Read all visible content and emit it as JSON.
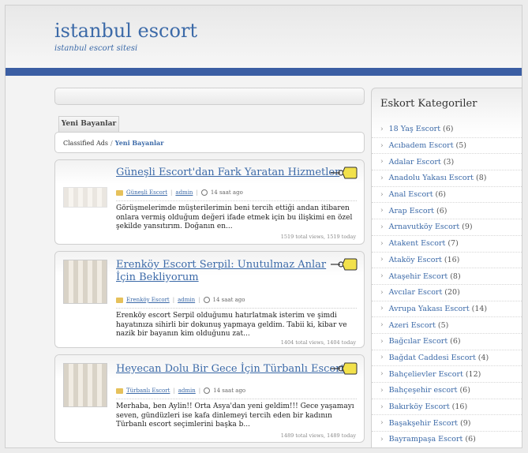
{
  "site": {
    "title": "istanbul escort",
    "tagline": "istanbul escort sitesi"
  },
  "tab_label": "Yeni Bayanlar",
  "breadcrumb": {
    "root": "Classified Ads",
    "separator": "/",
    "current": "Yeni Bayanlar"
  },
  "posts": [
    {
      "title": "Güneşli Escort'dan Fark Yaratan Hizmetler",
      "category": "Güneşli Escort",
      "author": "admin",
      "time": "14 saat ago",
      "excerpt": "Görüşmelerimde müşterilerimin beni tercih ettiği andan itibaren onlara vermiş olduğum değeri ifade etmek için bu ilişkimi en özel şekilde yansıtırım. Doğanın en...",
      "views": "1519 total views, 1519 today"
    },
    {
      "title": "Erenköy Escort Serpil: Unutulmaz Anlar İçin Bekliyorum",
      "category": "Erenköy Escort",
      "author": "admin",
      "time": "14 saat ago",
      "excerpt": "Erenköy escort Serpil olduğumu hatırlatmak isterim ve şimdi hayatınıza sihirli bir dokunuş yapmaya geldim. Tabii ki, kibar ve nazik bir bayanın kim olduğunu zat...",
      "views": "1404 total views, 1404 today"
    },
    {
      "title": "Heyecan Dolu Bir Gece İçin Türbanlı Escort",
      "category": "Türbanlı Escort",
      "author": "admin",
      "time": "14 saat ago",
      "excerpt": "Merhaba, ben Aylin!! Orta Asya'dan yeni geldim!!! Gece yaşamayı seven, gündüzleri ise kafa dinlemeyi tercih eden bir kadının Türbanlı escort seçimlerini başka b...",
      "views": "1489 total views, 1489 today"
    }
  ],
  "sidebar": {
    "title": "Eskort Kategoriler",
    "categories": [
      {
        "name": "18 Yaş Escort",
        "count": "(6)"
      },
      {
        "name": "Acıbadem Escort",
        "count": "(5)"
      },
      {
        "name": "Adalar Escort",
        "count": "(3)"
      },
      {
        "name": "Anadolu Yakası Escort",
        "count": "(8)"
      },
      {
        "name": "Anal Escort",
        "count": "(6)"
      },
      {
        "name": "Arap Escort",
        "count": "(6)"
      },
      {
        "name": "Arnavutköy Escort",
        "count": "(9)"
      },
      {
        "name": "Atakent Escort",
        "count": "(7)"
      },
      {
        "name": "Ataköy Escort",
        "count": "(16)"
      },
      {
        "name": "Ataşehir Escort",
        "count": "(8)"
      },
      {
        "name": "Avcılar Escort",
        "count": "(20)"
      },
      {
        "name": "Avrupa Yakası Escort",
        "count": "(14)"
      },
      {
        "name": "Azeri Escort",
        "count": "(5)"
      },
      {
        "name": "Bağcılar Escort",
        "count": "(6)"
      },
      {
        "name": "Bağdat Caddesi Escort",
        "count": "(4)"
      },
      {
        "name": "Bahçelievler Escort",
        "count": "(12)"
      },
      {
        "name": "Bahçeşehir escort",
        "count": "(6)"
      },
      {
        "name": "Bakırköy Escort",
        "count": "(16)"
      },
      {
        "name": "Başakşehir Escort",
        "count": "(9)"
      },
      {
        "name": "Bayrampaşa Escort",
        "count": "(6)"
      }
    ]
  },
  "colors": {
    "accent": "#3c6aa8",
    "header_bar": "#3b5ea3",
    "tag_yellow": "#f2e14b"
  }
}
